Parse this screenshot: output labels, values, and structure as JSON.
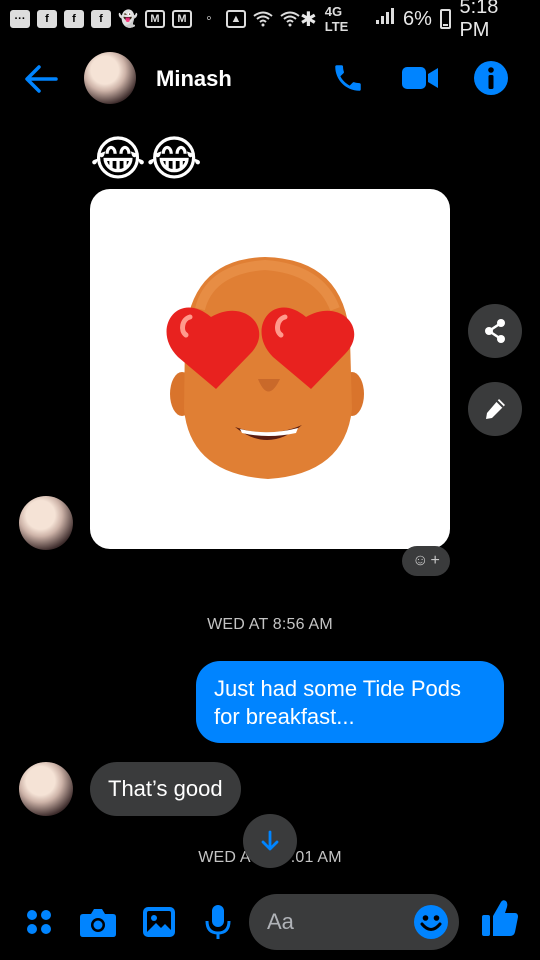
{
  "status_bar": {
    "icons_left": [
      "more-icon",
      "facebook-icon",
      "facebook-icon",
      "facebook-icon",
      "snapchat-icon",
      "gmail-icon",
      "email-icon",
      "chat-icon",
      "image-icon",
      "wifi-icon",
      "wifi-icon"
    ],
    "network": "4G LTE",
    "battery_percent": "6%",
    "time": "5:18 PM"
  },
  "header": {
    "contact_name": "Minash",
    "icons": [
      "back-arrow-icon",
      "phone-icon",
      "video-call-icon",
      "info-icon"
    ]
  },
  "messages": [
    {
      "type": "emoji",
      "from": "them",
      "content": "😂😂"
    },
    {
      "type": "sticker",
      "from": "them",
      "description_icon": "memoji-heart-eyes-sticker"
    },
    {
      "type": "timestamp",
      "text": "WED AT 8:56 AM"
    },
    {
      "type": "text",
      "from": "me",
      "text": "Just had some Tide Pods for breakfast..."
    },
    {
      "type": "text",
      "from": "them",
      "text": "That’s good"
    },
    {
      "type": "timestamp",
      "text": "WED A⁠T 9:01 AM",
      "visible_text": "WED A",
      "visible_text_2": ".01 AM"
    }
  ],
  "composer": {
    "placeholder": "Aa",
    "icons": [
      "apps-icon",
      "camera-icon",
      "gallery-icon",
      "microphone-icon",
      "emoji-icon",
      "like-icon"
    ]
  },
  "colors": {
    "accent": "#0084ff",
    "bubble_in": "#3a3b3c",
    "background": "#000000"
  }
}
